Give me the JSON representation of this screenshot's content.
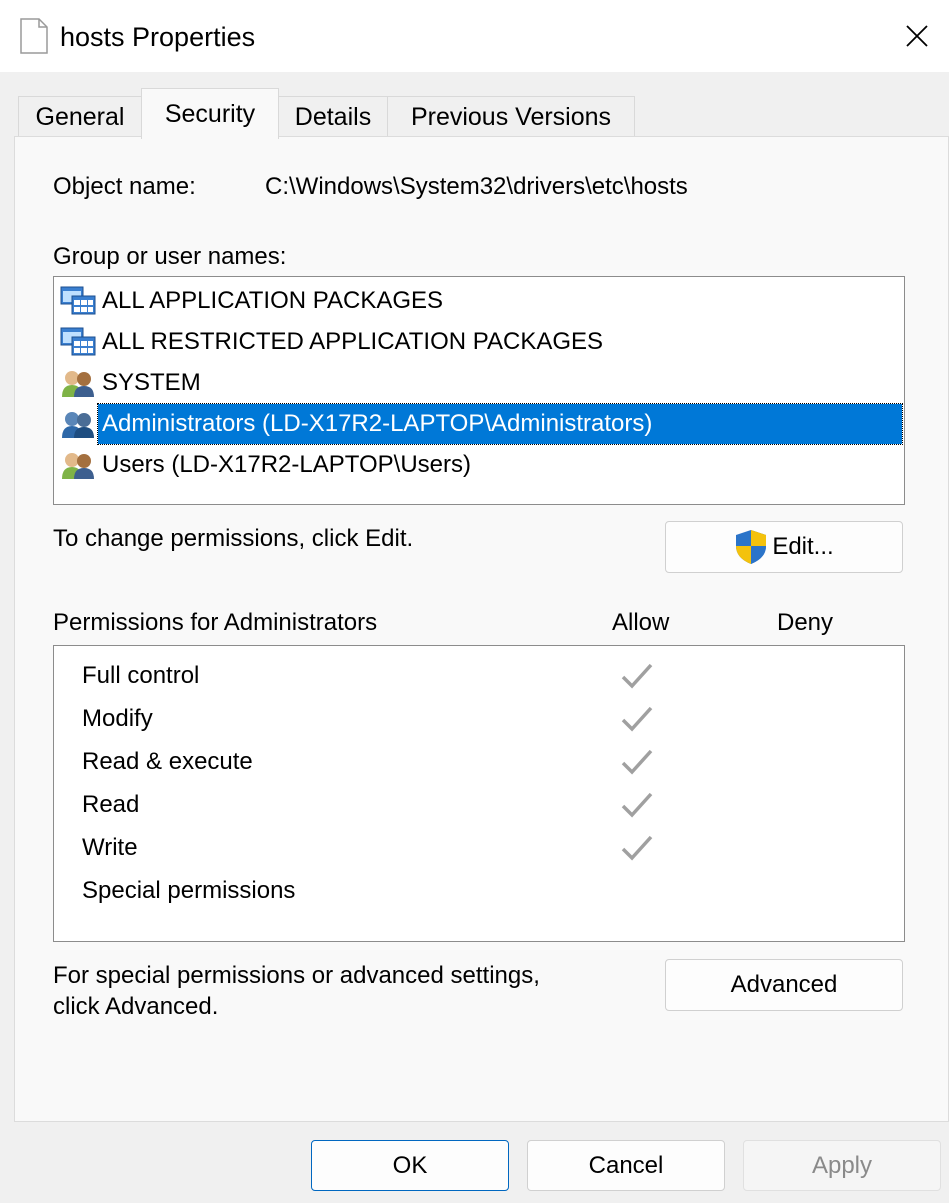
{
  "window": {
    "title": "hosts Properties"
  },
  "tabs": [
    {
      "label": "General"
    },
    {
      "label": "Security"
    },
    {
      "label": "Details"
    },
    {
      "label": "Previous Versions"
    }
  ],
  "security": {
    "object_name_label": "Object name:",
    "object_name_value": "C:\\Windows\\System32\\drivers\\etc\\hosts",
    "group_label": "Group or user names:",
    "groups": [
      {
        "name": "ALL APPLICATION PACKAGES",
        "icon": "app-packages-icon"
      },
      {
        "name": "ALL RESTRICTED APPLICATION PACKAGES",
        "icon": "app-packages-icon"
      },
      {
        "name": "SYSTEM",
        "icon": "users-group-icon"
      },
      {
        "name": "Administrators (LD-X17R2-LAPTOP\\Administrators)",
        "icon": "admin-group-icon",
        "selected": true
      },
      {
        "name": "Users (LD-X17R2-LAPTOP\\Users)",
        "icon": "users-group-icon"
      }
    ],
    "change_hint": "To change permissions, click Edit.",
    "edit_label": "Edit...",
    "permissions_for_label": "Permissions for Administrators",
    "allow_header": "Allow",
    "deny_header": "Deny",
    "permissions": [
      {
        "name": "Full control",
        "allow": true,
        "deny": false
      },
      {
        "name": "Modify",
        "allow": true,
        "deny": false
      },
      {
        "name": "Read & execute",
        "allow": true,
        "deny": false
      },
      {
        "name": "Read",
        "allow": true,
        "deny": false
      },
      {
        "name": "Write",
        "allow": true,
        "deny": false
      },
      {
        "name": "Special permissions",
        "allow": false,
        "deny": false
      }
    ],
    "advanced_hint_line1": "For special permissions or advanced settings,",
    "advanced_hint_line2": "click Advanced.",
    "advanced_label": "Advanced"
  },
  "footer": {
    "ok_label": "OK",
    "cancel_label": "Cancel",
    "apply_label": "Apply"
  },
  "colors": {
    "selection": "#0078d7",
    "check_disabled": "#a0a0a0"
  }
}
